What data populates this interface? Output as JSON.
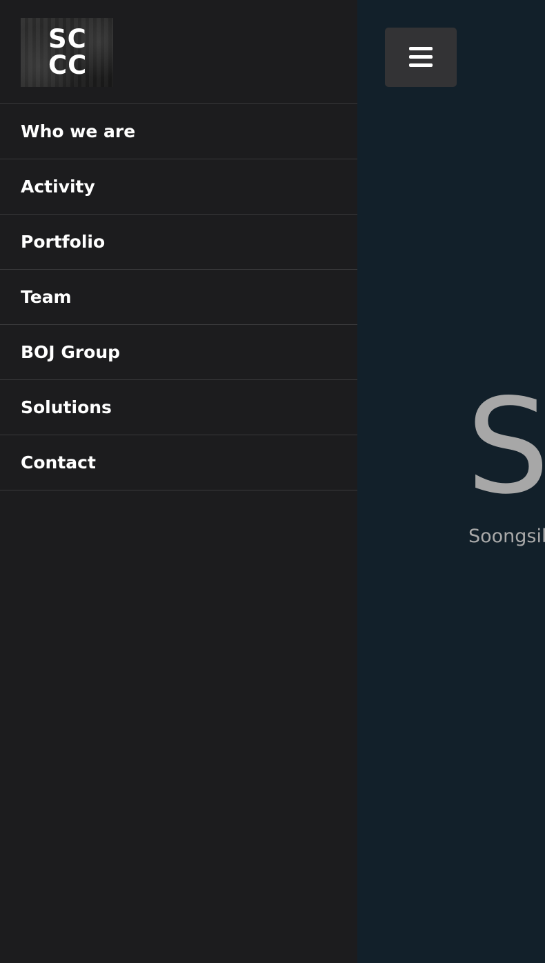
{
  "sidebar": {
    "logo_text": "SC\nCC",
    "items": [
      {
        "label": "Who we are"
      },
      {
        "label": "Activity"
      },
      {
        "label": "Portfolio"
      },
      {
        "label": "Team"
      },
      {
        "label": "BOJ Group"
      },
      {
        "label": "Solutions"
      },
      {
        "label": "Contact"
      }
    ]
  },
  "main": {
    "menu_button_icon": "hamburger-menu-icon",
    "hero_title": "S",
    "hero_subtitle": "Soongsil"
  },
  "colors": {
    "sidebar_bg": "#1c1c1e",
    "main_bg": "#12202a",
    "divider": "#3a3a3c",
    "menu_button_bg": "#333335",
    "hero_text": "#a7a7a7"
  }
}
